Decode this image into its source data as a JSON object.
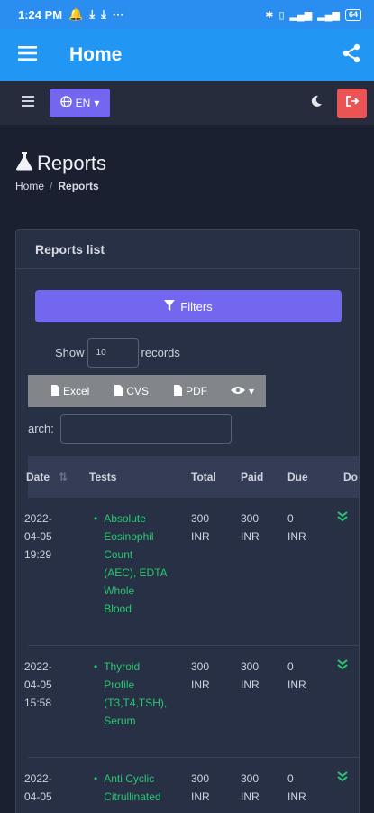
{
  "statusbar": {
    "time": "1:24 PM",
    "dots": "···",
    "battery": "64"
  },
  "appbar": {
    "title": "Home"
  },
  "toolbar": {
    "language": "EN"
  },
  "page": {
    "title": "Reports",
    "breadcrumb_home": "Home",
    "breadcrumb_current": "Reports"
  },
  "card": {
    "title": "Reports list",
    "filters_label": "Filters",
    "show_label": "Show",
    "records_label": "records",
    "page_length": "10",
    "search_label": "arch:"
  },
  "export": {
    "excel": "Excel",
    "csv": "CVS",
    "pdf": "PDF"
  },
  "table": {
    "headers": {
      "date": "Date",
      "tests": "Tests",
      "total": "Total",
      "paid": "Paid",
      "due": "Due",
      "done": "Do"
    },
    "rows": [
      {
        "date": "2022-\n04-05\n19:29",
        "test": "Absolute\nEosinophil\nCount\n(AEC), EDTA\nWhole\nBlood",
        "total": "300\nINR",
        "paid": "300\nINR",
        "due": "0\nINR"
      },
      {
        "date": "2022-\n04-05\n15:58",
        "test": "Thyroid\nProfile\n(T3,T4,TSH),\nSerum",
        "total": "300\nINR",
        "paid": "300\nINR",
        "due": "0\nINR"
      },
      {
        "date": "2022-\n04-05",
        "test": "Anti Cyclic\nCitrullinated",
        "total": "300\nINR",
        "paid": "300\nINR",
        "due": "0\nINR"
      }
    ]
  },
  "colors": {
    "primary": "#7367f0",
    "appbar": "#2196f3",
    "success": "#28c76f",
    "danger": "#ea5455",
    "bg": "#1b2030",
    "card": "#283046"
  },
  "icons": [
    "menu-icon",
    "share-icon",
    "globe-icon",
    "moon-icon",
    "logout-icon",
    "flask-icon",
    "filter-icon",
    "file-icon",
    "eye-icon",
    "sort-icon",
    "double-check-icon"
  ]
}
